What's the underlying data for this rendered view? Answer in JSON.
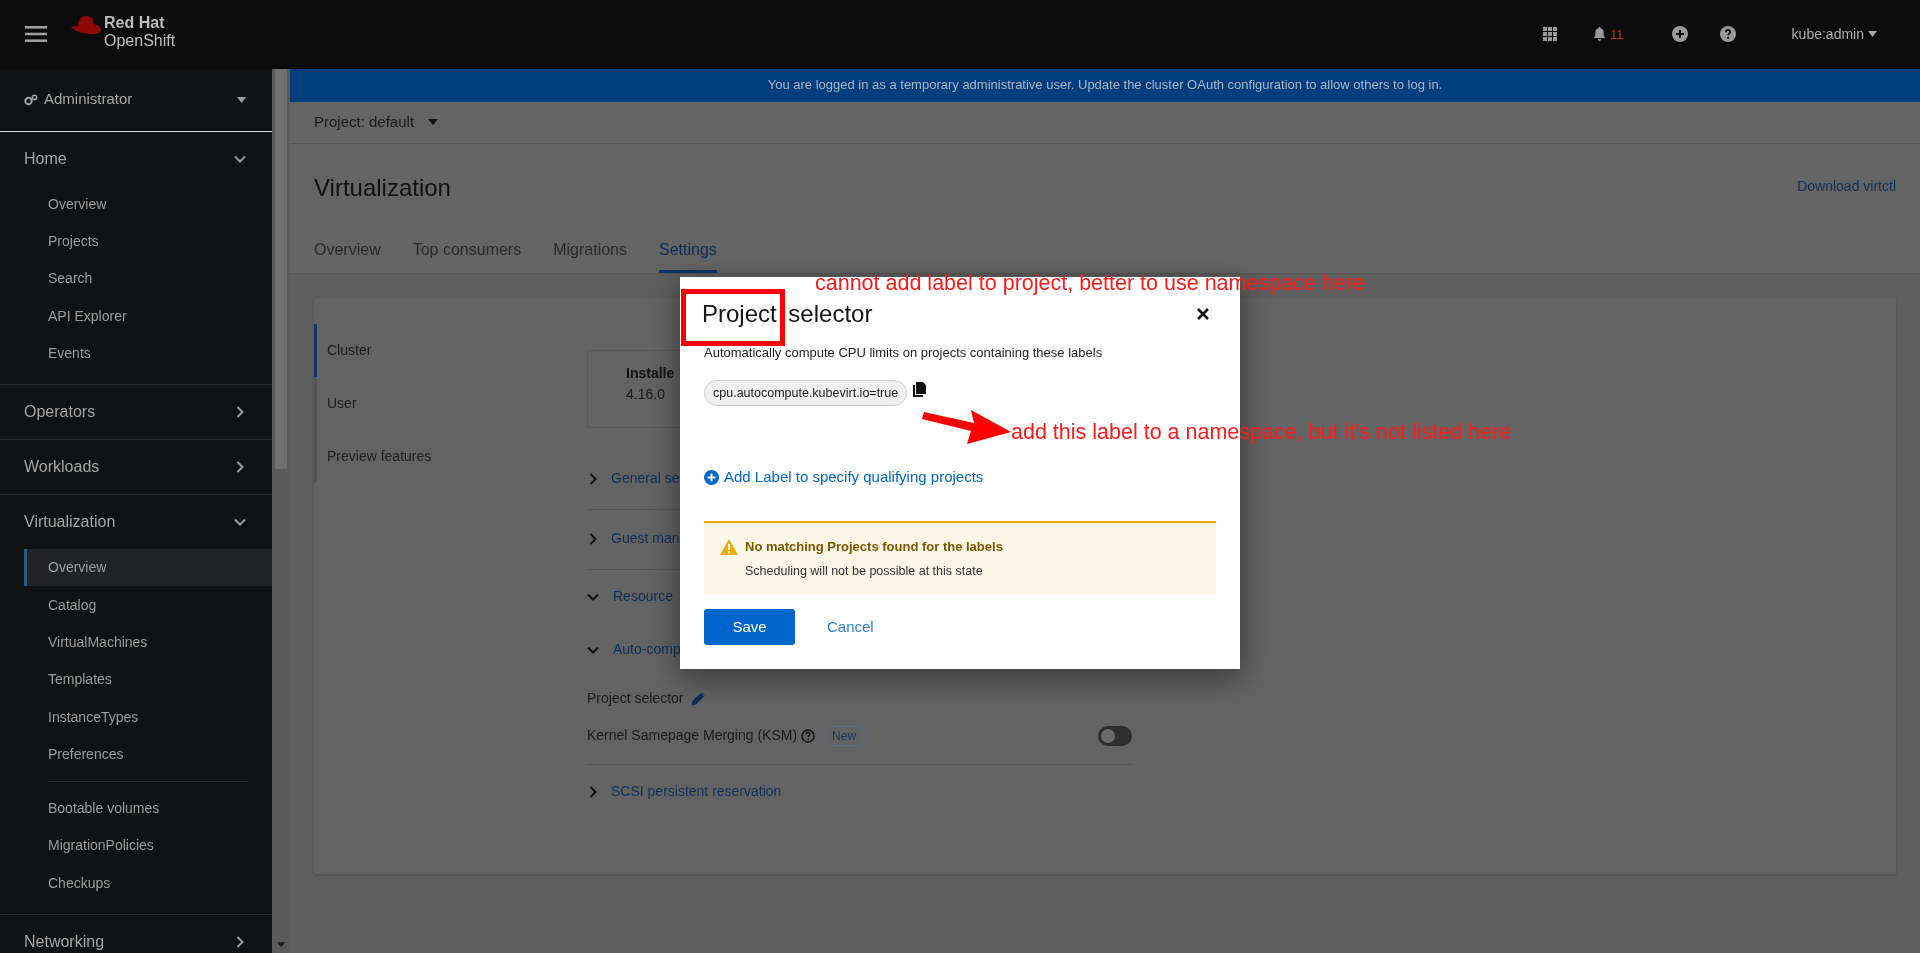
{
  "masthead": {
    "brand_top": "Red Hat",
    "brand_bottom": "OpenShift",
    "notification_count": "11",
    "user": "kube:admin"
  },
  "sidebar": {
    "perspective": "Administrator",
    "sections": [
      {
        "label": "Home",
        "expanded": true,
        "groups": [
          {
            "items": [
              {
                "label": "Overview",
                "selected": false
              },
              {
                "label": "Projects",
                "selected": false
              },
              {
                "label": "Search",
                "selected": false
              },
              {
                "label": "API Explorer",
                "selected": false
              },
              {
                "label": "Events",
                "selected": false
              }
            ]
          }
        ]
      },
      {
        "label": "Operators",
        "expanded": false
      },
      {
        "label": "Workloads",
        "expanded": false
      },
      {
        "label": "Virtualization",
        "expanded": true,
        "groups": [
          {
            "items": [
              {
                "label": "Overview",
                "selected": true
              },
              {
                "label": "Catalog",
                "selected": false
              },
              {
                "label": "VirtualMachines",
                "selected": false
              },
              {
                "label": "Templates",
                "selected": false
              },
              {
                "label": "InstanceTypes",
                "selected": false
              },
              {
                "label": "Preferences",
                "selected": false
              }
            ]
          },
          {
            "items": [
              {
                "label": "Bootable volumes",
                "selected": false
              },
              {
                "label": "MigrationPolicies",
                "selected": false
              },
              {
                "label": "Checkups",
                "selected": false
              }
            ]
          }
        ]
      },
      {
        "label": "Networking",
        "expanded": false
      }
    ]
  },
  "banner": {
    "text_before": "You are logged in as a temporary administrative user. Update the ",
    "link": "cluster OAuth configuration",
    "text_after": " to allow others to log in."
  },
  "project_bar": {
    "label": "Project: default"
  },
  "page": {
    "title": "Virtualization",
    "action_link": "Download virtctl",
    "tabs": [
      {
        "label": "Overview",
        "selected": false
      },
      {
        "label": "Top consumers",
        "selected": false
      },
      {
        "label": "Migrations",
        "selected": false
      },
      {
        "label": "Settings",
        "selected": true
      }
    ]
  },
  "settings": {
    "nav": [
      {
        "label": "Cluster",
        "selected": true
      },
      {
        "label": "User",
        "selected": false
      },
      {
        "label": "Preview features",
        "selected": false
      }
    ],
    "version_box": {
      "label": "Installe",
      "value": "4.16.0"
    },
    "rows": [
      {
        "kind": "section",
        "label": "General se",
        "expanded": false,
        "divider_after": true
      },
      {
        "kind": "section",
        "label": "Guest man",
        "expanded": false,
        "divider_after": true
      },
      {
        "kind": "section",
        "label": "Resource",
        "expanded": true,
        "divider_after": false
      },
      {
        "kind": "section",
        "label": "Auto-comp",
        "expanded": true,
        "divider_after": false
      },
      {
        "kind": "edit",
        "label": "Project selector",
        "divider_after": false
      },
      {
        "kind": "toggle",
        "label": "Kernel Samepage Merging (KSM)",
        "badge": "New",
        "on": false,
        "divider_after": true
      },
      {
        "kind": "section",
        "label": "SCSI persistent reservation",
        "expanded": false,
        "divider_after": false
      }
    ]
  },
  "modal": {
    "title": "Project selector",
    "description": "Automatically compute CPU limits on projects containing these labels",
    "labels": [
      "cpu.autocompute.kubevirt.io=true"
    ],
    "add_link": "Add Label to specify qualifying projects",
    "alert": {
      "title": "No matching Projects found for the labels",
      "body": "Scheduling will not be possible at this state"
    },
    "buttons": [
      {
        "label": "Save",
        "kind": "primary"
      },
      {
        "label": "Cancel",
        "kind": "link"
      }
    ]
  },
  "annotations": [
    {
      "text": "cannot add label to project, better to use namespace here"
    },
    {
      "text": "add this label to a namespace, but it's not listed here"
    }
  ]
}
